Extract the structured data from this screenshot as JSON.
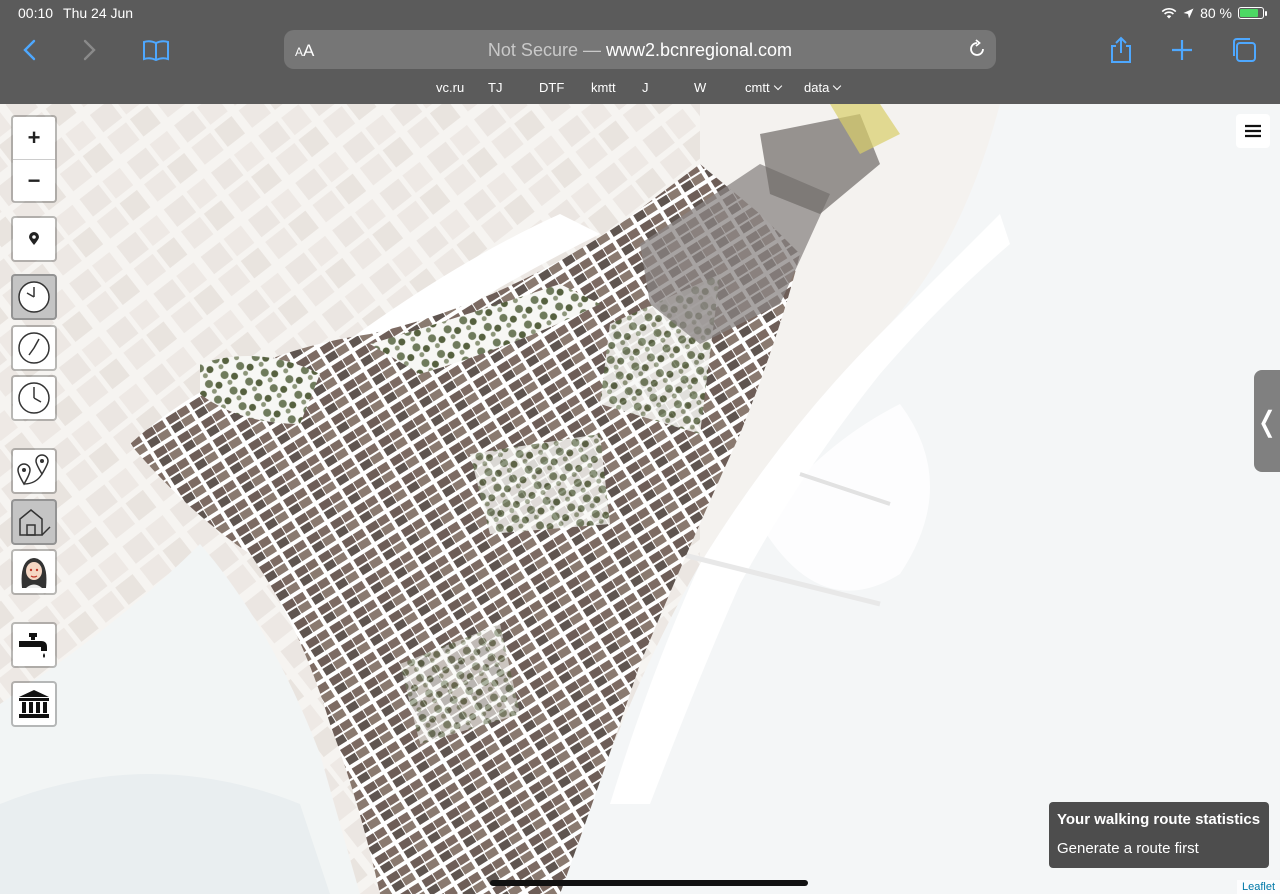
{
  "status_bar": {
    "time": "00:10",
    "date": "Thu 24 Jun",
    "battery": "80 %",
    "battery_level": 0.8
  },
  "browser": {
    "text_size_label": "AA",
    "url_prefix": "Not Secure — ",
    "url_host": "www2.bcnregional.com",
    "favorites": [
      {
        "label": "vc.ru"
      },
      {
        "label": "TJ"
      },
      {
        "label": "DTF"
      },
      {
        "label": "kmtt"
      },
      {
        "label": "J"
      },
      {
        "label": "W"
      },
      {
        "label": "cmtt"
      },
      {
        "label": "data"
      }
    ]
  },
  "map": {
    "zoom_in": "+",
    "zoom_out": "−",
    "sidebar_toggle": "❬",
    "attribution": "Leaflet"
  },
  "route_stats": {
    "title": "Your walking route statistics",
    "subtitle": "Generate a route first"
  }
}
